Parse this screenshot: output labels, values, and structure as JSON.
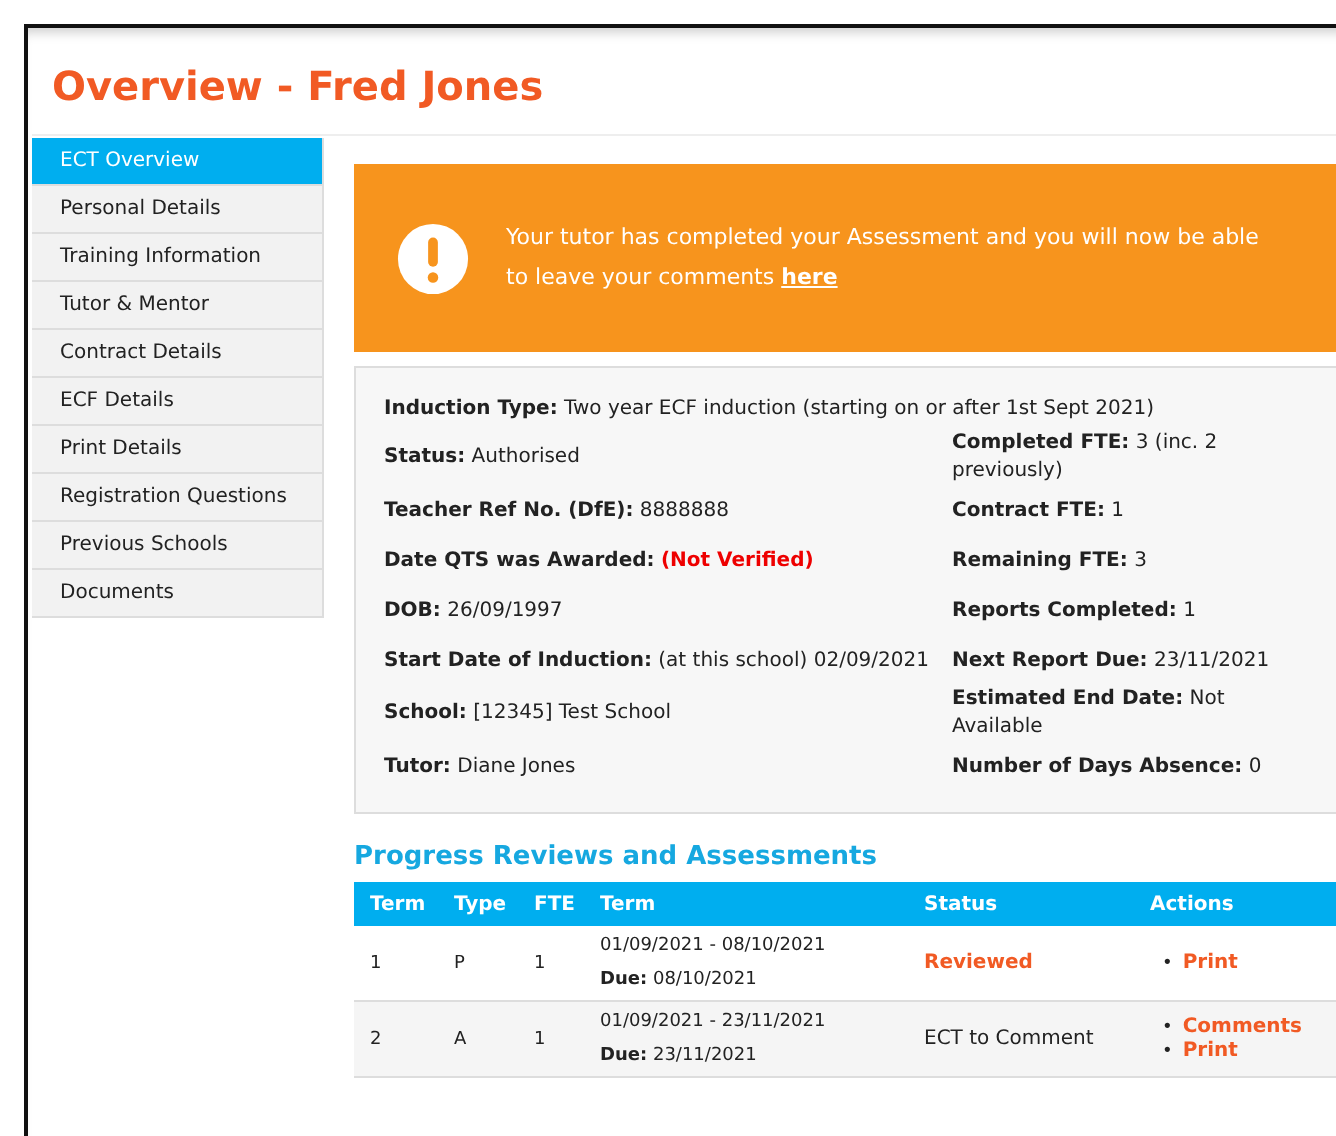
{
  "page": {
    "title": "Overview - Fred Jones"
  },
  "sidebar": {
    "items": [
      {
        "label": "ECT Overview",
        "selected": true
      },
      {
        "label": "Personal Details",
        "selected": false
      },
      {
        "label": "Training Information",
        "selected": false
      },
      {
        "label": "Tutor & Mentor",
        "selected": false
      },
      {
        "label": "Contract Details",
        "selected": false
      },
      {
        "label": "ECF Details",
        "selected": false
      },
      {
        "label": "Print Details",
        "selected": false
      },
      {
        "label": "Registration Questions",
        "selected": false
      },
      {
        "label": "Previous Schools",
        "selected": false
      },
      {
        "label": "Documents",
        "selected": false
      }
    ]
  },
  "alert": {
    "text": "Your tutor has completed your Assessment and you will now be able to leave your comments ",
    "link": "here"
  },
  "details": {
    "rows": [
      {
        "left": {
          "label": "Induction Type:",
          "value": "Two year ECF induction (starting on or after 1st Sept 2021)",
          "flagged": false
        }
      },
      {
        "left": {
          "label": "Status:",
          "value": "Authorised",
          "flagged": false
        },
        "right": {
          "label": "Completed FTE:",
          "value": "3 (inc. 2 previously)",
          "flagged": false
        }
      },
      {
        "left": {
          "label": "Teacher Ref No. (DfE):",
          "value": "8888888",
          "flagged": false
        },
        "right": {
          "label": "Contract FTE:",
          "value": "1",
          "flagged": false
        }
      },
      {
        "left": {
          "label": "Date QTS was Awarded:",
          "value": "(Not Verified)",
          "flagged": true
        },
        "right": {
          "label": "Remaining FTE:",
          "value": "3",
          "flagged": false
        }
      },
      {
        "left": {
          "label": "DOB:",
          "value": "26/09/1997",
          "flagged": false
        },
        "right": {
          "label": "Reports Completed:",
          "value": "1",
          "flagged": false
        }
      },
      {
        "left": {
          "label": "Start Date of Induction:",
          "value": "(at this school) 02/09/2021",
          "flagged": false
        },
        "right": {
          "label": "Next Report Due:",
          "value": "23/11/2021",
          "flagged": false
        }
      },
      {
        "left": {
          "label": "School:",
          "value": "[12345] Test School",
          "flagged": false
        },
        "right": {
          "label": "Estimated End Date:",
          "value": "Not Available",
          "flagged": false
        }
      },
      {
        "left": {
          "label": "Tutor:",
          "value": "Diane Jones",
          "flagged": false
        },
        "right": {
          "label": "Number of Days Absence:",
          "value": "0",
          "flagged": false
        }
      }
    ]
  },
  "reviews": {
    "heading": "Progress Reviews and Assessments",
    "columns": [
      "Term",
      "Type",
      "FTE",
      "Term",
      "Status",
      "Actions"
    ],
    "rows": [
      {
        "term": "1",
        "type": "P",
        "fte": "1",
        "period": "01/09/2021 - 08/10/2021",
        "due_label": "Due:",
        "due": "08/10/2021",
        "status": "Reviewed",
        "highlighted": true,
        "actions": [
          {
            "marker": "•",
            "label": "Print"
          }
        ]
      },
      {
        "term": "2",
        "type": "A",
        "fte": "1",
        "period": "01/09/2021 - 23/11/2021",
        "due_label": "Due:",
        "due": "23/11/2021",
        "status": "ECT to Comment",
        "highlighted": false,
        "actions": [
          {
            "marker": "•",
            "label": "Comments"
          },
          {
            "marker": "•",
            "label": "Print"
          }
        ]
      }
    ]
  }
}
